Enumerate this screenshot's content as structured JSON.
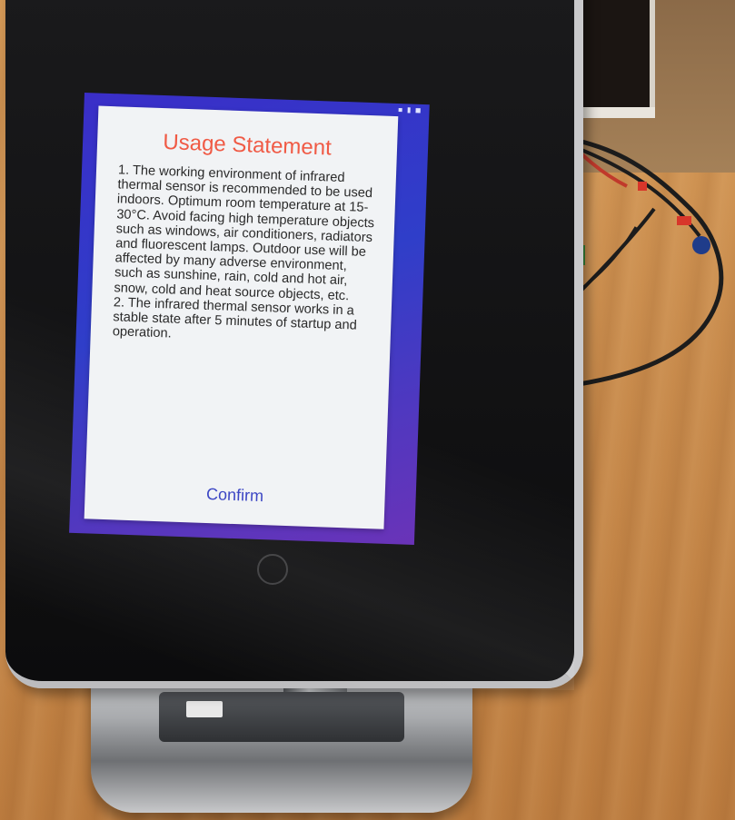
{
  "dialog": {
    "title": "Usage Statement",
    "body": "1. The working environment of infrared thermal sensor is recommended to be used indoors. Optimum room temperature at 15-30°C. Avoid facing high temperature objects such as windows, air conditioners, radiators and fluorescent lamps. Outdoor use will be affected by many adverse environment, such as sunshine, rain, cold and hot air, snow, cold and heat source objects, etc.\n2. The infrared thermal sensor works in a stable state after 5 minutes of startup and operation.",
    "confirm_label": "Confirm"
  },
  "colors": {
    "title": "#f05a45",
    "confirm": "#3c46c4",
    "dialog_bg": "#f1f3f5",
    "screen_bg": "#3a2ec8"
  },
  "icons": {
    "home": "home-button-icon"
  }
}
